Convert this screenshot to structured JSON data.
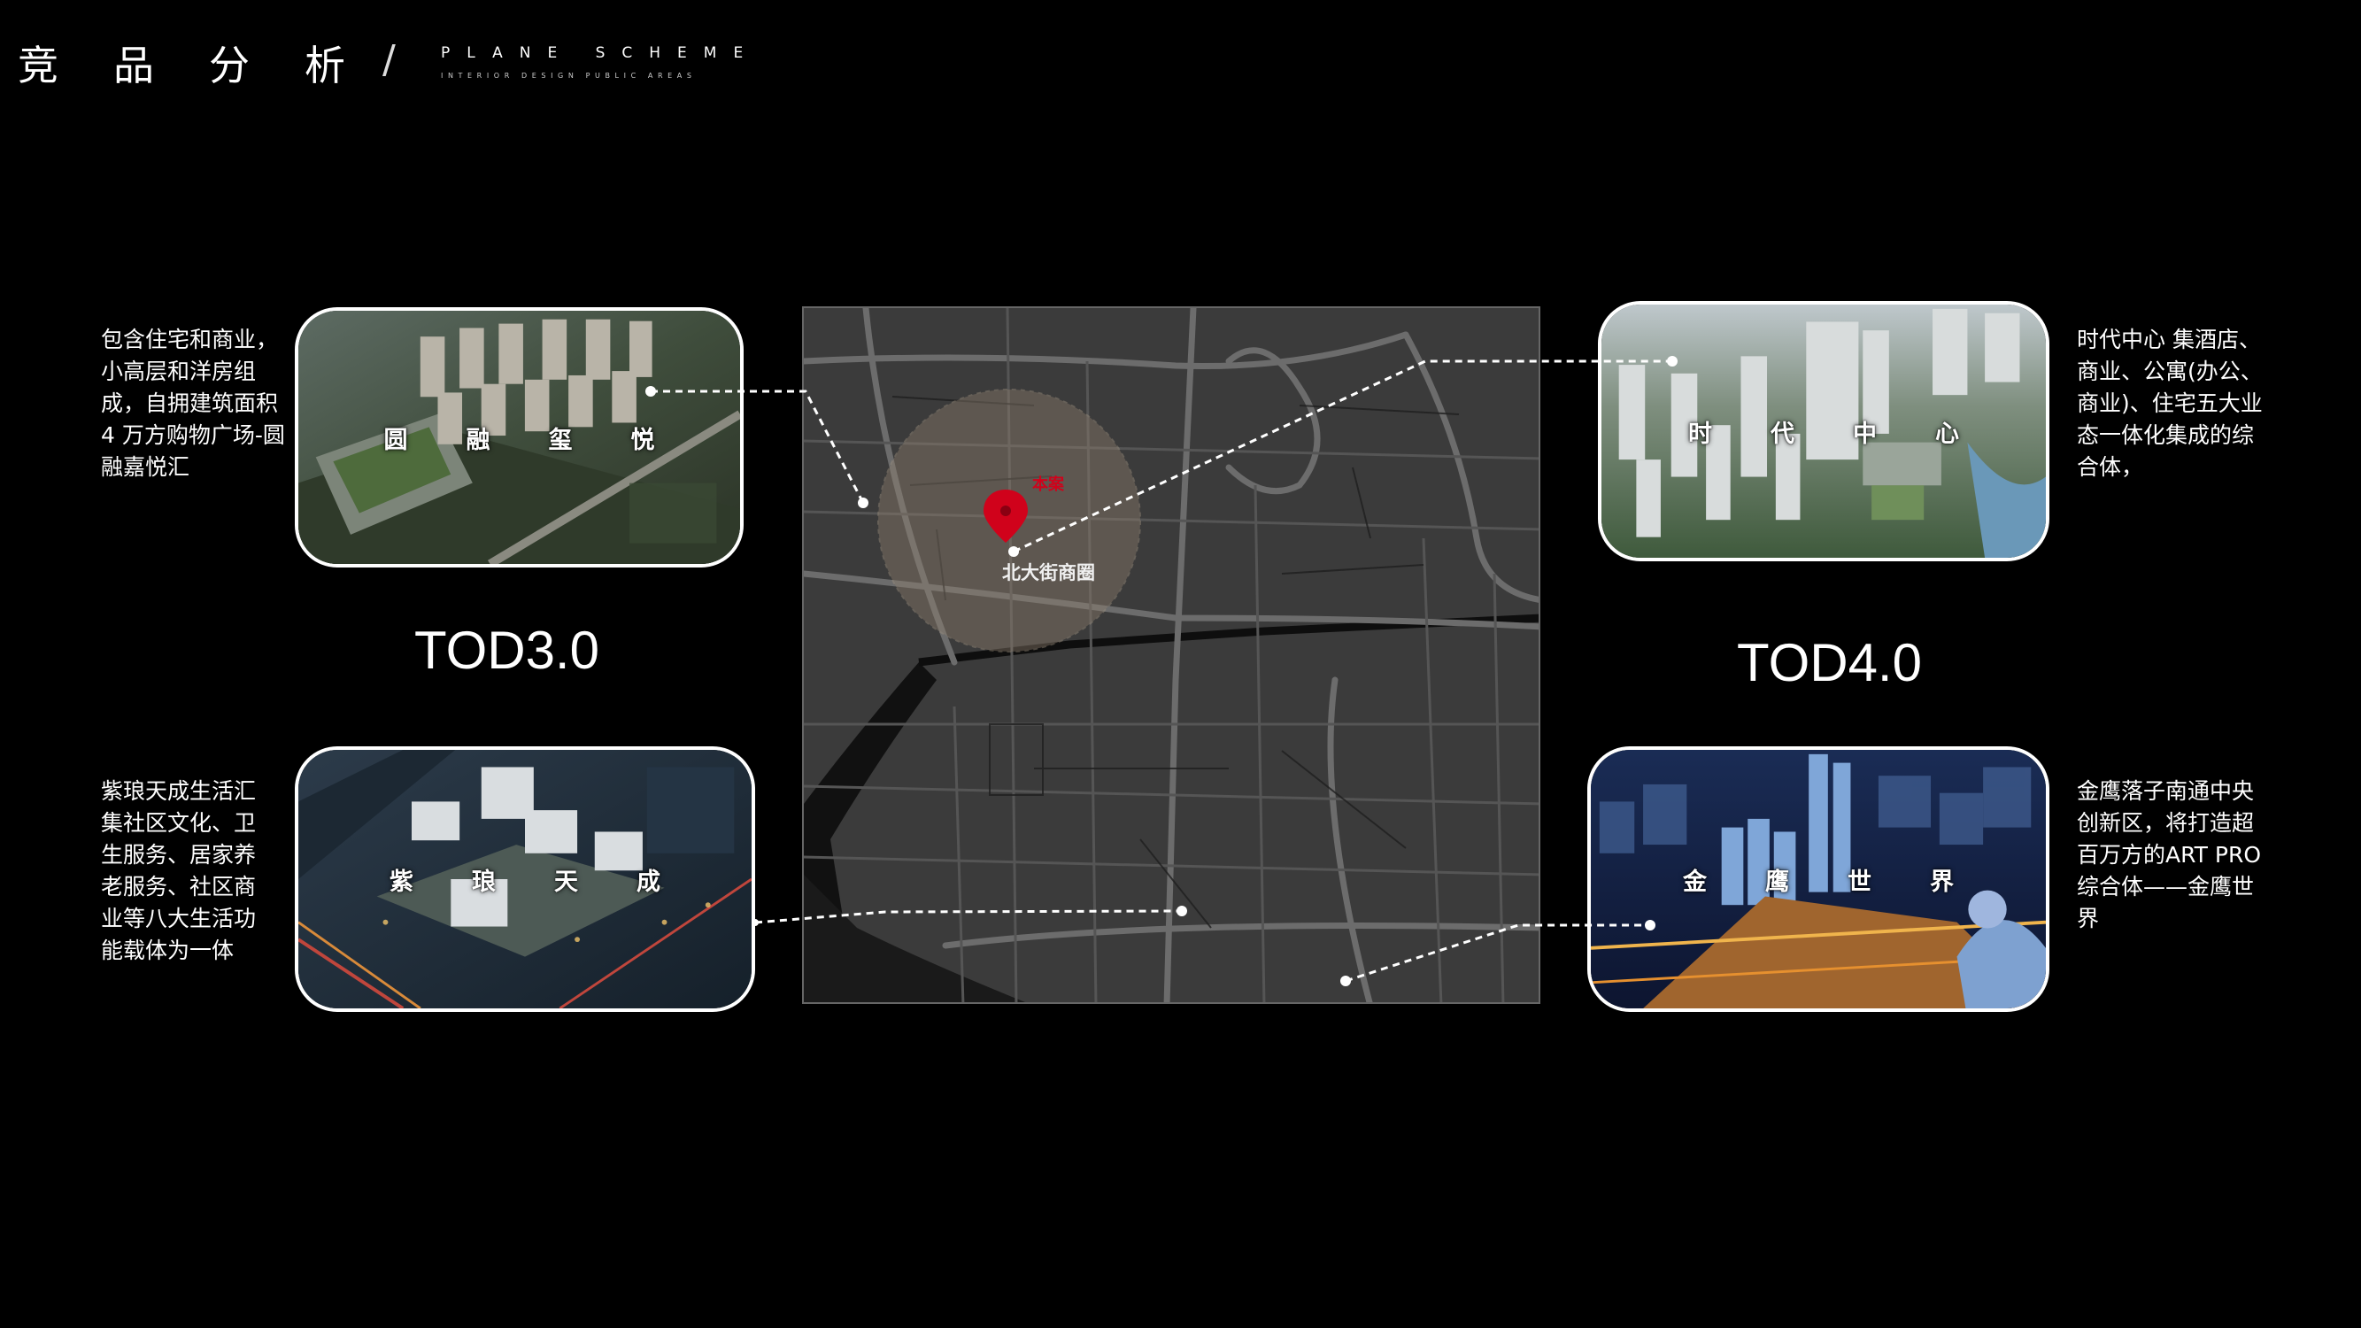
{
  "header": {
    "title_cn": "竞品分析",
    "title_en": "PLANE SCHEME",
    "subtitle_en": "INTERIOR DESIGN PUBLIC AREAS"
  },
  "tod_labels": {
    "left": "TOD3.0",
    "right": "TOD4.0"
  },
  "projects": [
    {
      "name": "圆融玺悦",
      "desc": "包含住宅和商业，小高层和洋房组成，自拥建筑面积4 万方购物广场-圆融嘉悦汇"
    },
    {
      "name": "紫琅天成",
      "desc": "紫琅天成生活汇集社区文化、卫生服务、居家养老服务、社区商业等八大生活功能载体为一体"
    },
    {
      "name": "时代中心",
      "desc": "时代中心 集酒店、商业、公寓(办公、商业)、住宅五大业态一体化集成的综合体，"
    },
    {
      "name": "金鹰世界",
      "desc": "金鹰落子南通中央创新区，将打造超百万方的ART PRO综合体——金鹰世界"
    }
  ],
  "map": {
    "project_marker_label": "本案",
    "district_label": "北大街商圈",
    "marker_color": "#d0021b"
  }
}
